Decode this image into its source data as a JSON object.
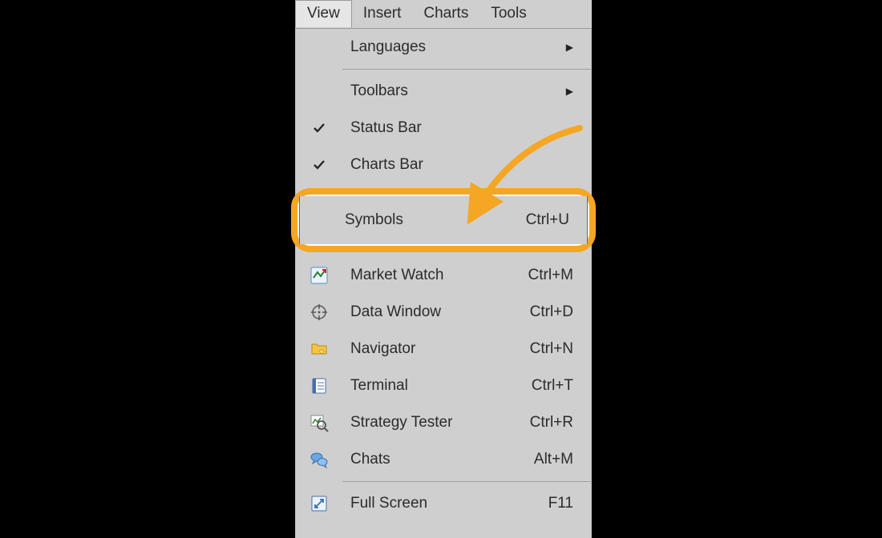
{
  "menubar": {
    "items": [
      {
        "label": "View",
        "active": true
      },
      {
        "label": "Insert",
        "active": false
      },
      {
        "label": "Charts",
        "active": false
      },
      {
        "label": "Tools",
        "active": false
      }
    ]
  },
  "menu": {
    "languages": {
      "label": "Languages",
      "has_submenu": true
    },
    "toolbars": {
      "label": "Toolbars",
      "has_submenu": true
    },
    "status_bar": {
      "label": "Status Bar",
      "checked": true
    },
    "charts_bar": {
      "label": "Charts Bar",
      "checked": true
    },
    "symbols": {
      "label": "Symbols",
      "shortcut": "Ctrl+U",
      "highlighted": true
    },
    "market_watch": {
      "label": "Market Watch",
      "shortcut": "Ctrl+M",
      "icon": "market-watch-icon"
    },
    "data_window": {
      "label": "Data Window",
      "shortcut": "Ctrl+D",
      "icon": "crosshair-icon"
    },
    "navigator": {
      "label": "Navigator",
      "shortcut": "Ctrl+N",
      "icon": "folder-star-icon"
    },
    "terminal": {
      "label": "Terminal",
      "shortcut": "Ctrl+T",
      "icon": "notebook-icon"
    },
    "strategy_tester": {
      "label": "Strategy Tester",
      "shortcut": "Ctrl+R",
      "icon": "chart-magnifier-icon"
    },
    "chats": {
      "label": "Chats",
      "shortcut": "Alt+M",
      "icon": "chat-bubbles-icon"
    },
    "full_screen": {
      "label": "Full Screen",
      "shortcut": "F11",
      "icon": "fullscreen-icon"
    }
  },
  "annotation": {
    "arrow_color": "#f5a623",
    "callout_border_color": "#f5a623"
  }
}
